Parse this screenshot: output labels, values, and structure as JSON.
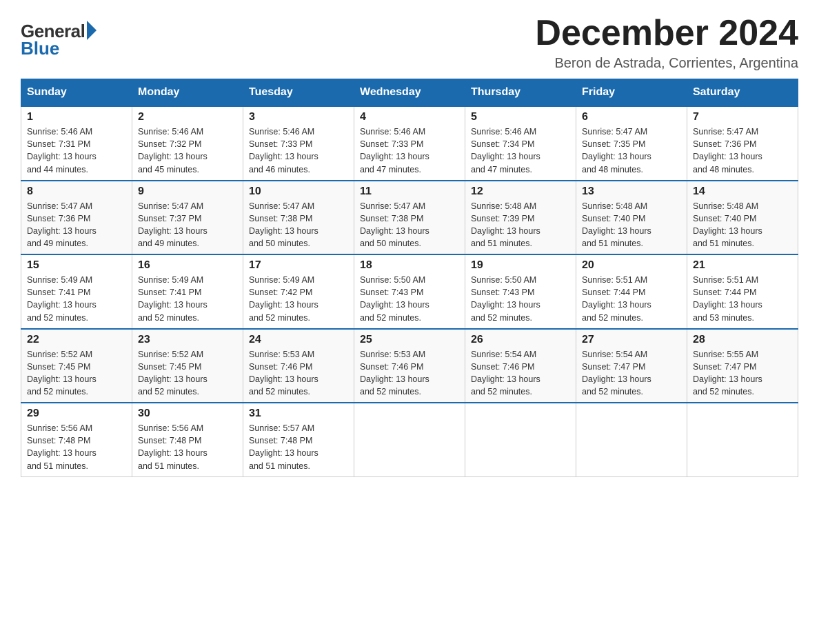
{
  "logo": {
    "general": "General",
    "blue": "Blue"
  },
  "title": {
    "month_year": "December 2024",
    "location": "Beron de Astrada, Corrientes, Argentina"
  },
  "days_of_week": [
    "Sunday",
    "Monday",
    "Tuesday",
    "Wednesday",
    "Thursday",
    "Friday",
    "Saturday"
  ],
  "weeks": [
    [
      {
        "day": "1",
        "sunrise": "5:46 AM",
        "sunset": "7:31 PM",
        "daylight": "13 hours and 44 minutes."
      },
      {
        "day": "2",
        "sunrise": "5:46 AM",
        "sunset": "7:32 PM",
        "daylight": "13 hours and 45 minutes."
      },
      {
        "day": "3",
        "sunrise": "5:46 AM",
        "sunset": "7:33 PM",
        "daylight": "13 hours and 46 minutes."
      },
      {
        "day": "4",
        "sunrise": "5:46 AM",
        "sunset": "7:33 PM",
        "daylight": "13 hours and 47 minutes."
      },
      {
        "day": "5",
        "sunrise": "5:46 AM",
        "sunset": "7:34 PM",
        "daylight": "13 hours and 47 minutes."
      },
      {
        "day": "6",
        "sunrise": "5:47 AM",
        "sunset": "7:35 PM",
        "daylight": "13 hours and 48 minutes."
      },
      {
        "day": "7",
        "sunrise": "5:47 AM",
        "sunset": "7:36 PM",
        "daylight": "13 hours and 48 minutes."
      }
    ],
    [
      {
        "day": "8",
        "sunrise": "5:47 AM",
        "sunset": "7:36 PM",
        "daylight": "13 hours and 49 minutes."
      },
      {
        "day": "9",
        "sunrise": "5:47 AM",
        "sunset": "7:37 PM",
        "daylight": "13 hours and 49 minutes."
      },
      {
        "day": "10",
        "sunrise": "5:47 AM",
        "sunset": "7:38 PM",
        "daylight": "13 hours and 50 minutes."
      },
      {
        "day": "11",
        "sunrise": "5:47 AM",
        "sunset": "7:38 PM",
        "daylight": "13 hours and 50 minutes."
      },
      {
        "day": "12",
        "sunrise": "5:48 AM",
        "sunset": "7:39 PM",
        "daylight": "13 hours and 51 minutes."
      },
      {
        "day": "13",
        "sunrise": "5:48 AM",
        "sunset": "7:40 PM",
        "daylight": "13 hours and 51 minutes."
      },
      {
        "day": "14",
        "sunrise": "5:48 AM",
        "sunset": "7:40 PM",
        "daylight": "13 hours and 51 minutes."
      }
    ],
    [
      {
        "day": "15",
        "sunrise": "5:49 AM",
        "sunset": "7:41 PM",
        "daylight": "13 hours and 52 minutes."
      },
      {
        "day": "16",
        "sunrise": "5:49 AM",
        "sunset": "7:41 PM",
        "daylight": "13 hours and 52 minutes."
      },
      {
        "day": "17",
        "sunrise": "5:49 AM",
        "sunset": "7:42 PM",
        "daylight": "13 hours and 52 minutes."
      },
      {
        "day": "18",
        "sunrise": "5:50 AM",
        "sunset": "7:43 PM",
        "daylight": "13 hours and 52 minutes."
      },
      {
        "day": "19",
        "sunrise": "5:50 AM",
        "sunset": "7:43 PM",
        "daylight": "13 hours and 52 minutes."
      },
      {
        "day": "20",
        "sunrise": "5:51 AM",
        "sunset": "7:44 PM",
        "daylight": "13 hours and 52 minutes."
      },
      {
        "day": "21",
        "sunrise": "5:51 AM",
        "sunset": "7:44 PM",
        "daylight": "13 hours and 53 minutes."
      }
    ],
    [
      {
        "day": "22",
        "sunrise": "5:52 AM",
        "sunset": "7:45 PM",
        "daylight": "13 hours and 52 minutes."
      },
      {
        "day": "23",
        "sunrise": "5:52 AM",
        "sunset": "7:45 PM",
        "daylight": "13 hours and 52 minutes."
      },
      {
        "day": "24",
        "sunrise": "5:53 AM",
        "sunset": "7:46 PM",
        "daylight": "13 hours and 52 minutes."
      },
      {
        "day": "25",
        "sunrise": "5:53 AM",
        "sunset": "7:46 PM",
        "daylight": "13 hours and 52 minutes."
      },
      {
        "day": "26",
        "sunrise": "5:54 AM",
        "sunset": "7:46 PM",
        "daylight": "13 hours and 52 minutes."
      },
      {
        "day": "27",
        "sunrise": "5:54 AM",
        "sunset": "7:47 PM",
        "daylight": "13 hours and 52 minutes."
      },
      {
        "day": "28",
        "sunrise": "5:55 AM",
        "sunset": "7:47 PM",
        "daylight": "13 hours and 52 minutes."
      }
    ],
    [
      {
        "day": "29",
        "sunrise": "5:56 AM",
        "sunset": "7:48 PM",
        "daylight": "13 hours and 51 minutes."
      },
      {
        "day": "30",
        "sunrise": "5:56 AM",
        "sunset": "7:48 PM",
        "daylight": "13 hours and 51 minutes."
      },
      {
        "day": "31",
        "sunrise": "5:57 AM",
        "sunset": "7:48 PM",
        "daylight": "13 hours and 51 minutes."
      },
      null,
      null,
      null,
      null
    ]
  ],
  "labels": {
    "sunrise": "Sunrise:",
    "sunset": "Sunset:",
    "daylight": "Daylight:"
  }
}
